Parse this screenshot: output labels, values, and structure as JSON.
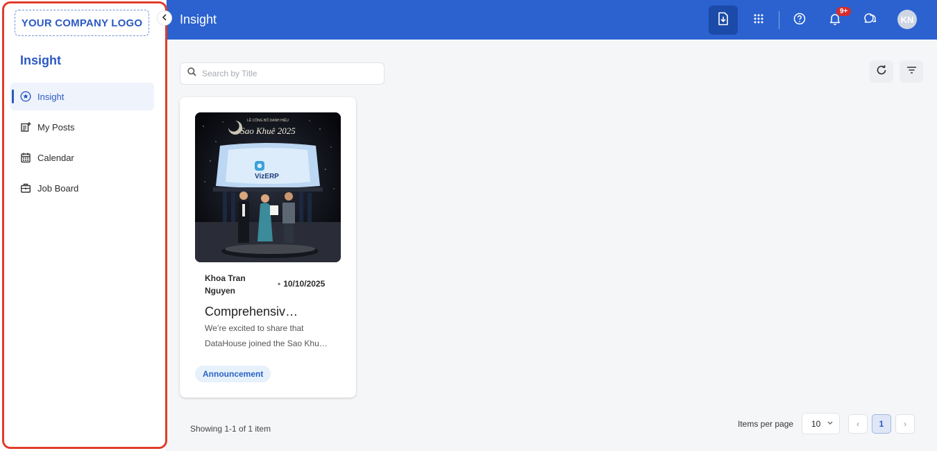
{
  "sidebar": {
    "logo_text": "YOUR COMPANY LOGO",
    "title": "Insight",
    "items": [
      {
        "label": "Insight",
        "icon": "star-circle-icon",
        "active": true
      },
      {
        "label": "My Posts",
        "icon": "post-add-icon",
        "active": false
      },
      {
        "label": "Calendar",
        "icon": "calendar-icon",
        "active": false
      },
      {
        "label": "Job Board",
        "icon": "briefcase-icon",
        "active": false
      }
    ]
  },
  "header": {
    "title": "Insight",
    "notifications_badge": "9+",
    "avatar_initials": "KN",
    "icons": [
      "download-file-icon",
      "apps-grid-icon",
      "help-icon",
      "bell-icon",
      "chat-icon"
    ]
  },
  "search": {
    "placeholder": "Search by Title",
    "value": ""
  },
  "post": {
    "author": "Khoa Tran Nguyen",
    "date_separator": "•",
    "date": "10/10/2025",
    "title": "Comprehensive…",
    "description_line1": "We’re excited to share that",
    "description_line2": "DataHouse joined the Sao Khu…",
    "tag": "Announcement",
    "image": {
      "banner_text": "Sao Khuê 2025",
      "screen_text": "VizERP"
    }
  },
  "footer": {
    "showing": "Showing 1-1 of 1 item",
    "items_per_page_label": "Items per page",
    "items_per_page_value": "10",
    "current_page": "1",
    "prev_symbol": "‹",
    "next_symbol": "›"
  },
  "colors": {
    "brand": "#2b62d0",
    "accent": "#2b59c3",
    "highlight": "#e23b2b",
    "badge": "#d62c2c"
  }
}
